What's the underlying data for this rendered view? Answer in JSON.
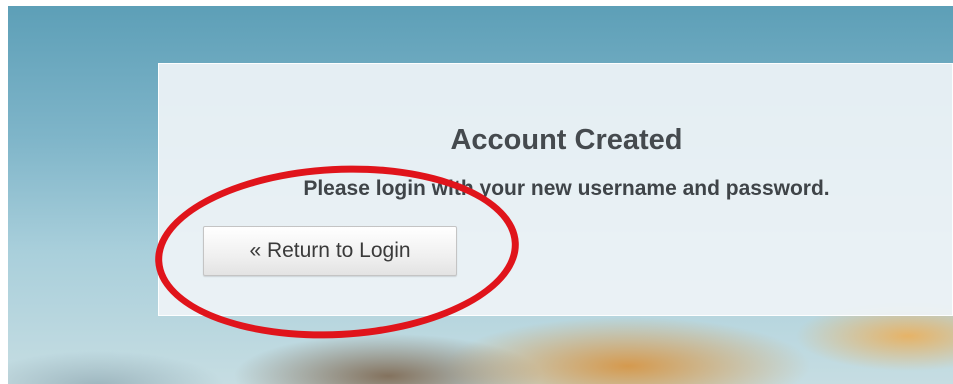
{
  "dialog": {
    "title": "Account Created",
    "message": "Please login with your new username and password.",
    "return_button_label": "« Return to Login"
  },
  "colors": {
    "highlight_ring": "#e0141b",
    "panel_background": "#eef3f6",
    "title_text": "#454a4e"
  }
}
